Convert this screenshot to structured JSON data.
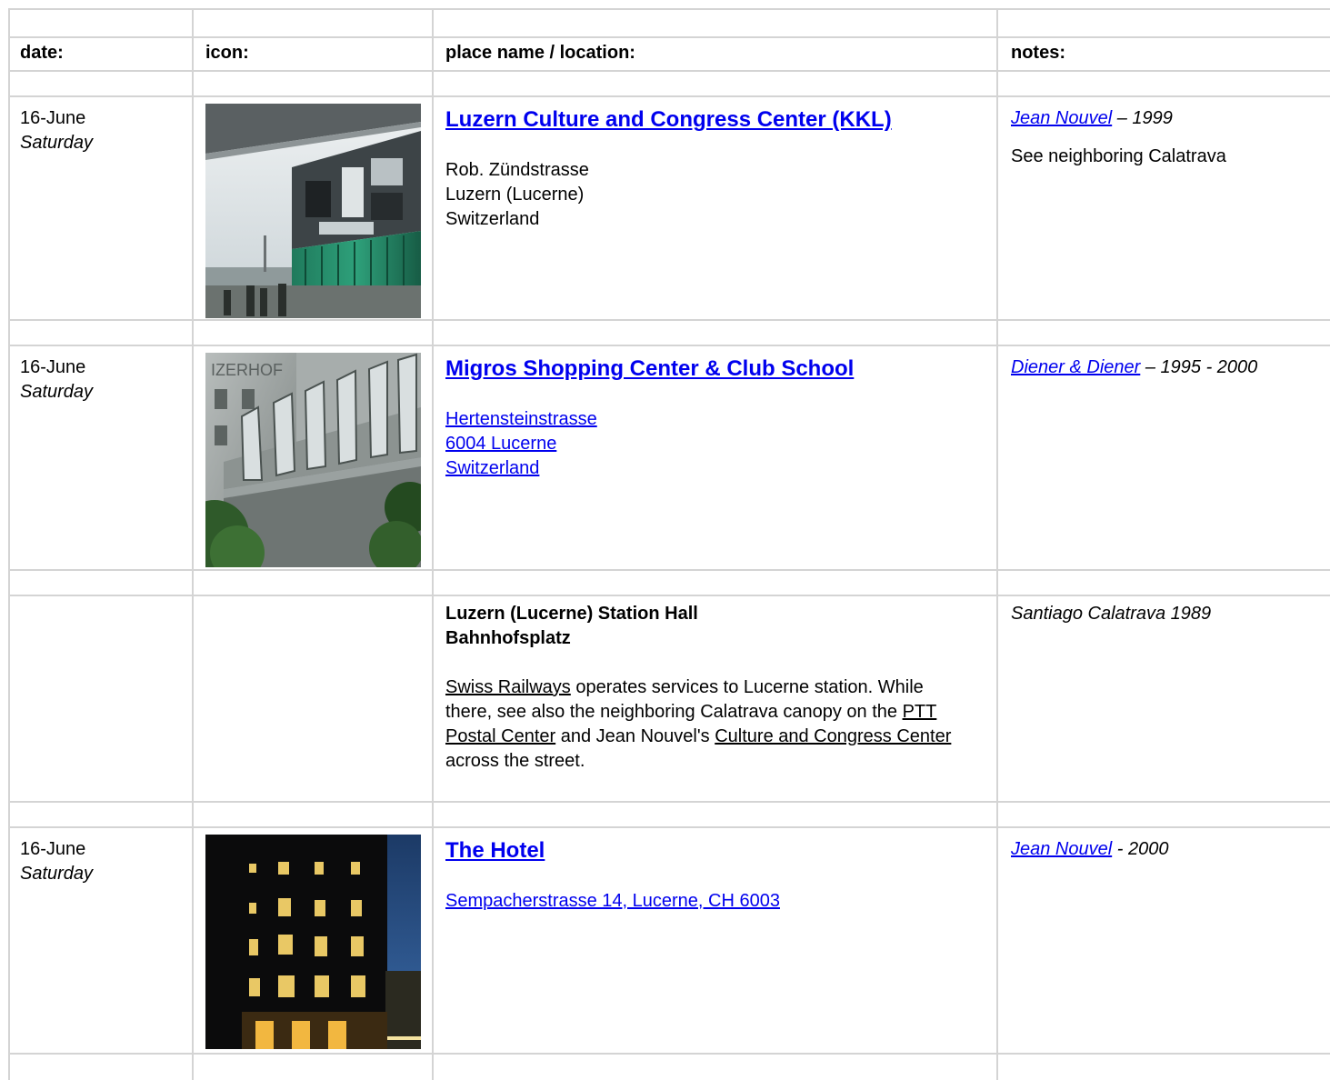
{
  "header": {
    "date": "date:",
    "icon": "icon:",
    "place": "place name / location:",
    "notes": "notes:"
  },
  "rows": [
    {
      "date": "16-June",
      "day": "Saturday",
      "title": "Luzern Culture and Congress Center (KKL)",
      "address": [
        "Rob. Zündstrasse",
        "Luzern (Lucerne)",
        "Switzerland"
      ],
      "architect": "Jean Nouvel",
      "year": " – 1999",
      "note": "See neighboring Calatrava"
    },
    {
      "date": "16-June",
      "day": "Saturday",
      "title": "Migros Shopping Center & Club School",
      "address": [
        "Hertensteinstrasse",
        "6004 Lucerne",
        "Switzerland"
      ],
      "architect": "Diener & Diener",
      "year": " – 1995 - 2000",
      "photo_sign": "IZERHOF"
    },
    {
      "title_line1": "Luzern (Lucerne) Station Hall",
      "title_line2": "Bahnhofsplatz",
      "desc": {
        "link1": "Swiss Railways",
        "t1": " operates services to Lucerne station. While there, see also the neighboring Calatrava canopy on the ",
        "link2": "PTT Postal Center",
        "t2": " and Jean Nouvel's ",
        "link3": "Culture and Congress Center",
        "t3": " across the street."
      },
      "notes": "Santiago Calatrava 1989"
    },
    {
      "date": "16-June",
      "day": "Saturday",
      "title": "The Hotel ",
      "address": "Sempacherstrasse 14, Lucerne, CH 6003",
      "architect": "Jean Nouvel",
      "year": " - 2000"
    }
  ],
  "colors": {
    "link": "#0000ee",
    "grid": "#d4d4d4"
  }
}
